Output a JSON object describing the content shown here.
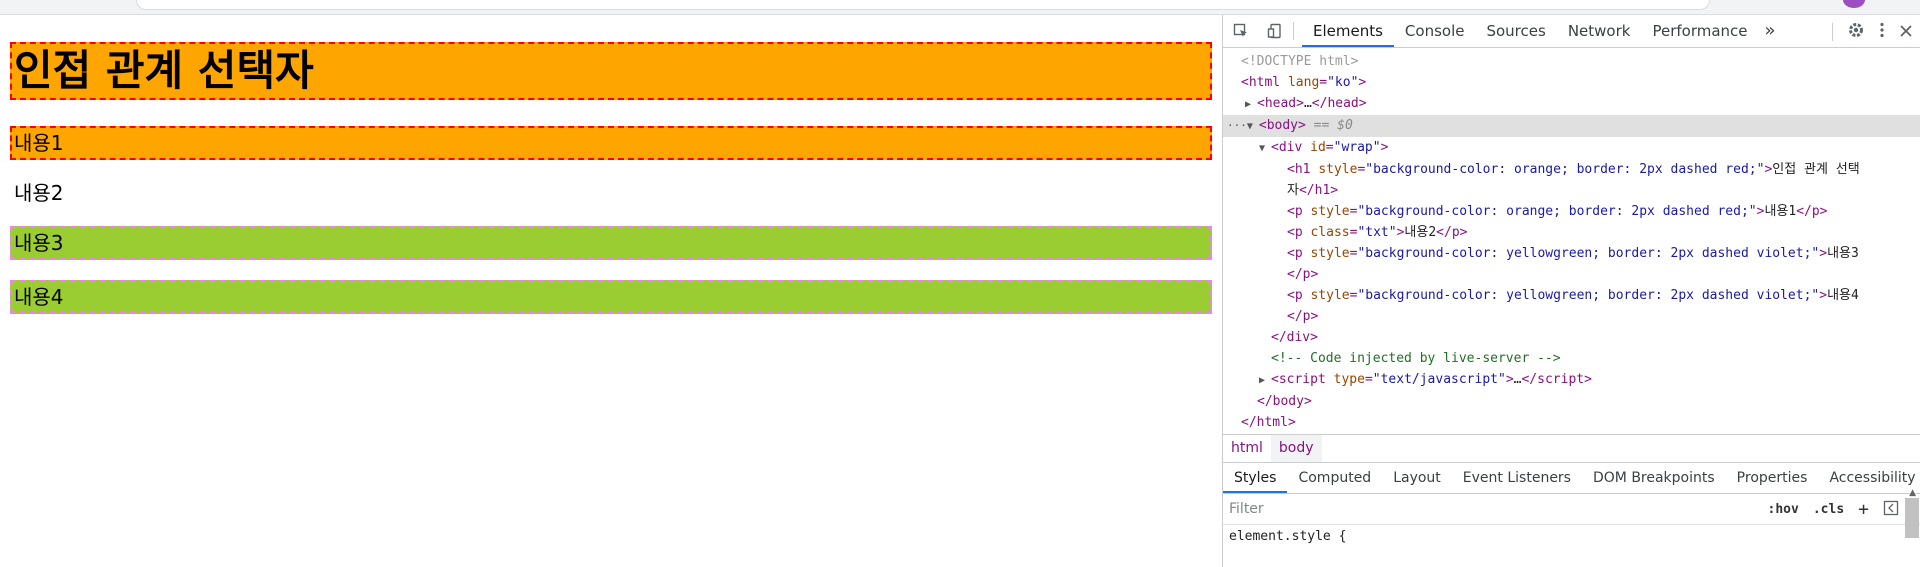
{
  "page": {
    "heading": "인접 관계 선택자",
    "p1": "내용1",
    "p2": "내용2",
    "p3": "내용3",
    "p4": "내용4"
  },
  "devtools": {
    "tabs": [
      "Elements",
      "Console",
      "Sources",
      "Network",
      "Performance"
    ],
    "more_tabs": "»",
    "dom": {
      "doctype": "<!DOCTYPE html>",
      "html_open_tag": "html",
      "html_lang_attr": "lang",
      "html_lang_val": "\"ko\"",
      "head_collapsed": "…",
      "body_tag": "body",
      "body_eq": "== $0",
      "div_attr": "id",
      "div_val": "\"wrap\"",
      "h1_style": "\"background-color: orange; border: 2px dashed red;\"",
      "h1_text_a": "인접 관계 선택",
      "h1_text_b": "자",
      "p1_style": "\"background-color: orange; border: 2px dashed red;\"",
      "p1_text": "내용1",
      "p2_class_val": "\"txt\"",
      "p2_text": "내용2",
      "p3_style": "\"background-color: yellowgreen; border: 2px dashed violet;\"",
      "p3_text": "내용3",
      "p4_style": "\"background-color: yellowgreen; border: 2px dashed violet;\"",
      "p4_text": "내용4",
      "comment": "<!-- Code injected by live-server -->",
      "script_type_val": "\"text/javascript\"",
      "script_collapsed": "…"
    },
    "breadcrumbs": [
      "html",
      "body"
    ],
    "style_tabs": [
      "Styles",
      "Computed",
      "Layout",
      "Event Listeners",
      "DOM Breakpoints",
      "Properties",
      "Accessibility"
    ],
    "filter_placeholder": "Filter",
    "hov": ":hov",
    "cls": ".cls",
    "element_style": "element.style {"
  },
  "colors": {
    "orange": "#ffa500",
    "yellowgreen": "#9acd32",
    "accent": "#1a73e8"
  }
}
